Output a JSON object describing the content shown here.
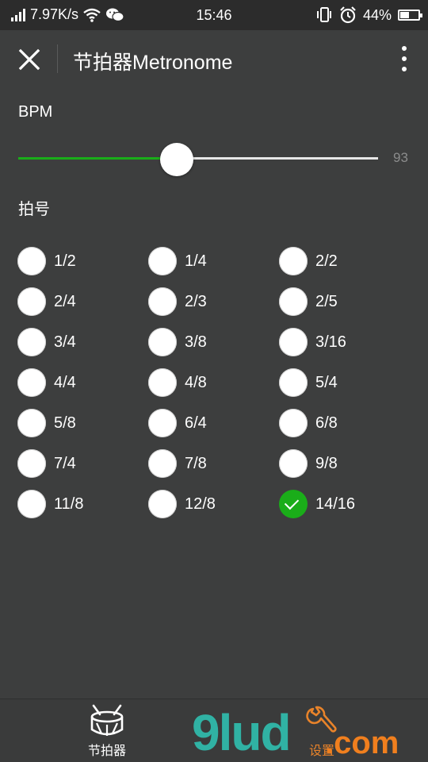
{
  "status_bar": {
    "network_speed": "7.97K/s",
    "time": "15:46",
    "battery_percent": "44%",
    "battery_level": 0.44,
    "icons": [
      "signal-icon",
      "wifi-icon",
      "wechat-icon",
      "vibrate-icon",
      "alarm-icon",
      "battery-icon"
    ]
  },
  "app_bar": {
    "title": "节拍器Metronome",
    "close_icon": "close-icon",
    "more_icon": "more-vert-icon"
  },
  "bpm": {
    "label": "BPM",
    "value": "93",
    "slider_fraction": 0.44,
    "accent_color": "#1aad19"
  },
  "time_signature": {
    "label": "拍号",
    "options": [
      {
        "label": "1/2",
        "checked": false
      },
      {
        "label": "1/4",
        "checked": false
      },
      {
        "label": "2/2",
        "checked": false
      },
      {
        "label": "2/4",
        "checked": false
      },
      {
        "label": "2/3",
        "checked": false
      },
      {
        "label": "2/5",
        "checked": false
      },
      {
        "label": "3/4",
        "checked": false
      },
      {
        "label": "3/8",
        "checked": false
      },
      {
        "label": "3/16",
        "checked": false
      },
      {
        "label": "4/4",
        "checked": false
      },
      {
        "label": "4/8",
        "checked": false
      },
      {
        "label": "5/4",
        "checked": false
      },
      {
        "label": "5/8",
        "checked": false
      },
      {
        "label": "6/4",
        "checked": false
      },
      {
        "label": "6/8",
        "checked": false
      },
      {
        "label": "7/4",
        "checked": false
      },
      {
        "label": "7/8",
        "checked": false
      },
      {
        "label": "9/8",
        "checked": false
      },
      {
        "label": "11/8",
        "checked": false
      },
      {
        "label": "12/8",
        "checked": false
      },
      {
        "label": "14/16",
        "checked": true
      }
    ]
  },
  "tabs": {
    "metronome": {
      "label": "节拍器",
      "icon": "drum-icon"
    },
    "settings": {
      "label": "设置",
      "icon": "wrench-icon"
    }
  },
  "watermark": {
    "text": "9lud",
    "suffix": ".com"
  }
}
